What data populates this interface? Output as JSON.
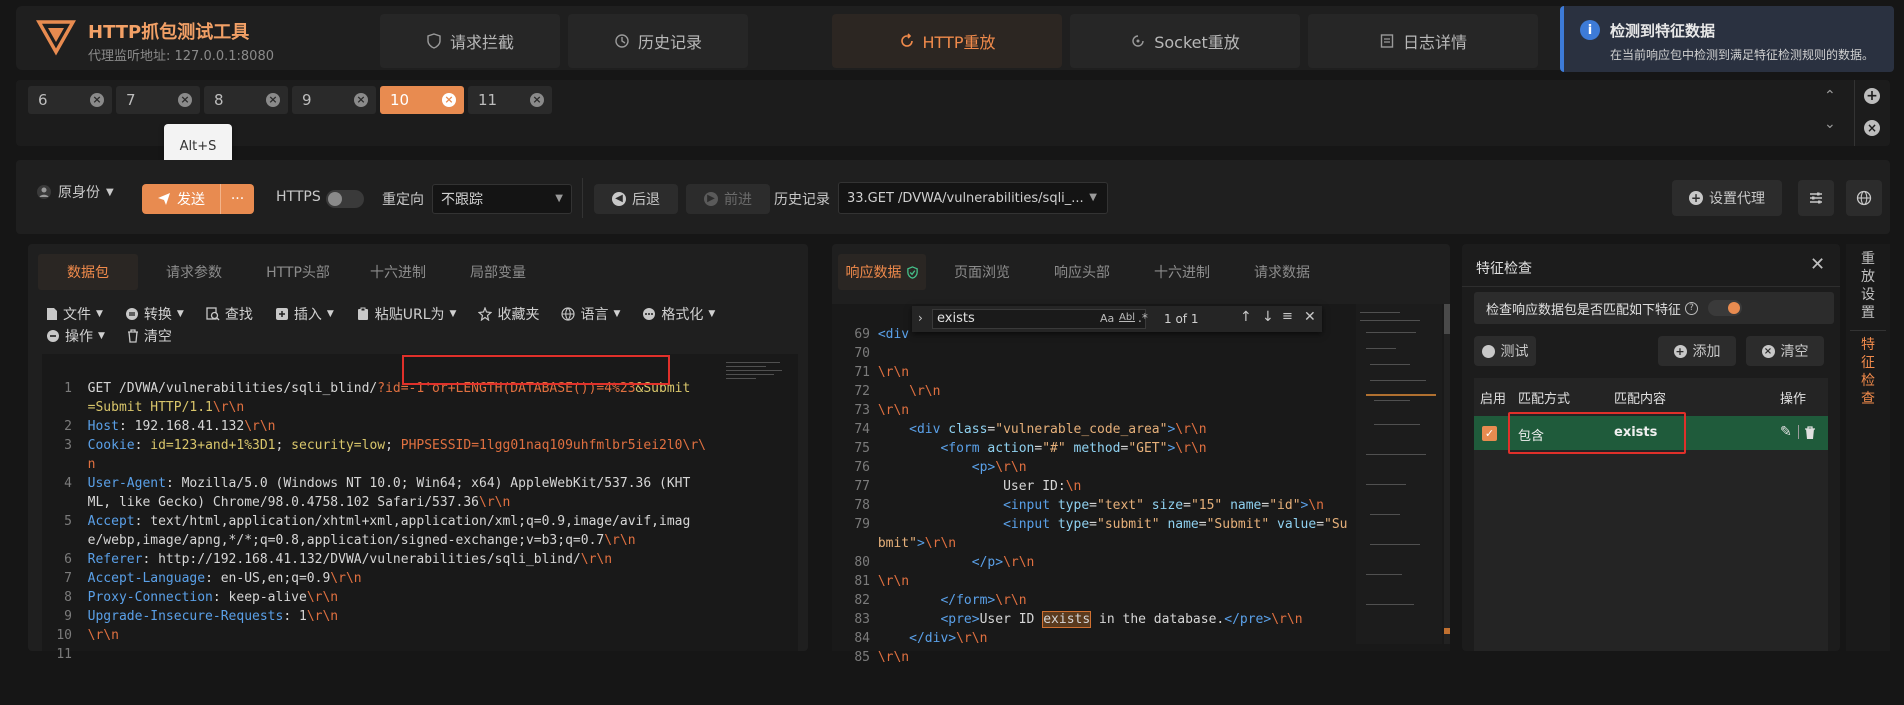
{
  "app": {
    "title": "HTTP抓包测试工具",
    "proxy_label": "代理监听地址: 127.0.0.1:8080"
  },
  "nav": {
    "tabs": [
      {
        "label": "请求拦截",
        "icon": "shield-icon"
      },
      {
        "label": "历史记录",
        "icon": "history-icon"
      },
      {
        "label": "HTTP重放",
        "icon": "replay-icon",
        "active": true
      },
      {
        "label": "Socket重放",
        "icon": "socket-icon"
      },
      {
        "label": "日志详情",
        "icon": "log-icon"
      }
    ]
  },
  "notification": {
    "title": "检测到特征数据",
    "message": "在当前响应包中检测到满足特征检测规则的数据。"
  },
  "session_tabs": [
    {
      "label": "6"
    },
    {
      "label": "7"
    },
    {
      "label": "8"
    },
    {
      "label": "9"
    },
    {
      "label": "10",
      "active": true
    },
    {
      "label": "11"
    }
  ],
  "tooltip": "Alt+S",
  "toolbar": {
    "identity": "原身份",
    "send": "发送",
    "more": "···",
    "https_label": "HTTPS",
    "redirect_label": "重定向",
    "redirect_value": "不跟踪",
    "back": "后退",
    "forward": "前进",
    "history_label": "历史记录",
    "history_value": "33.GET /DVWA/vulnerabilities/sqli_...",
    "proxy_settings": "设置代理"
  },
  "request_panel": {
    "tabs": [
      "数据包",
      "请求参数",
      "HTTP头部",
      "十六进制",
      "局部变量"
    ],
    "actions": {
      "file": "文件",
      "convert": "转换",
      "find": "查找",
      "insert": "插入",
      "paste_url": "粘贴URL为",
      "favorites": "收藏夹",
      "language": "语言",
      "format": "格式化",
      "operate": "操作",
      "clear": "清空"
    },
    "lines": {
      "l1a": "GET /DVWA/vulnerabilities/sqli_blind/",
      "l1b": "?id=-1'or+LENGTH(DATABASE())=4%23",
      "l1c": "&Submit",
      "l1d": "=Submit HTTP/1.1",
      "host_k": "Host",
      "host_v": " 192.168.41.132",
      "cookie_k": "Cookie",
      "cookie_v1": "id=123+and+1%3D1",
      "cookie_v2": "security=low",
      "cookie_v3": "PHPSESSID=1lgg01naq109uhfmlbr5iei2l0",
      "ua_k": "User-Agent",
      "ua_v1": " Mozilla/5.0 (Windows NT 10.0; Win64; x64) AppleWebKit/537.36 (KHT",
      "ua_v2": "ML, like Gecko) Chrome/98.0.4758.102 Safari/537.36",
      "accept_k": "Accept",
      "accept_v1": " text/html,application/xhtml+xml,application/xml;q=0.9,image/avif,imag",
      "accept_v2": "e/webp,image/apng,*/*;q=0.8,application/signed-exchange;v=b3;q=0.7",
      "referer_k": "Referer",
      "referer_v": " http://192.168.41.132/DVWA/vulnerabilities/sqli_blind/",
      "lang_k": "Accept-Language",
      "lang_v": " en-US,en;q=0.9",
      "conn_k": "Proxy-Connection",
      "conn_v": " keep-alive",
      "uir_k": "Upgrade-Insecure-Requests",
      "uir_v": " 1"
    }
  },
  "response_panel": {
    "tabs": [
      "响应数据",
      "页面浏览",
      "响应头部",
      "十六进制",
      "请求数据"
    ],
    "search": {
      "value": "exists",
      "opt_case": "Aa",
      "opt_word": "Abl",
      "opt_regex": ".*",
      "count": "1 of 1"
    },
    "lines": {
      "l74_attr": "class",
      "l74_str": "\"vulnerable_code_area\"",
      "l75_a1": "action",
      "l75_s1": "\"#\"",
      "l75_a2": "method",
      "l75_s2": "\"GET\"",
      "l77": "User ID:",
      "l78_a1": "type",
      "l78_s1": "\"text\"",
      "l78_a2": "size",
      "l78_s2": "\"15\"",
      "l78_a3": "name",
      "l78_s3": "\"id\"",
      "l79_a1": "type",
      "l79_s1": "\"submit\"",
      "l79_a2": "name",
      "l79_s2": "\"Submit\"",
      "l79_a3": "value",
      "l79_s3": "\"Su",
      "l79b": "bmit\"",
      "l84_text1": "User ID ",
      "l84_match": "exists",
      "l84_text2": " in the database."
    }
  },
  "feature_panel": {
    "title": "特征检查",
    "toggle_label": "检查响应数据包是否匹配如下特征",
    "test": "测试",
    "add": "添加",
    "clear": "清空",
    "columns": {
      "enabled": "启用",
      "match_type": "匹配方式",
      "match_content": "匹配内容",
      "actions": "操作"
    },
    "rows": [
      {
        "enabled": true,
        "match_type": "包含",
        "match_content": "exists"
      }
    ]
  },
  "side_tabs": {
    "replay_settings": "重放设置",
    "feature_check": "特征检查"
  },
  "colors": {
    "accent": "#f08a4b",
    "highlight_red": "#e0302a",
    "row_green": "#1f5b3b"
  }
}
